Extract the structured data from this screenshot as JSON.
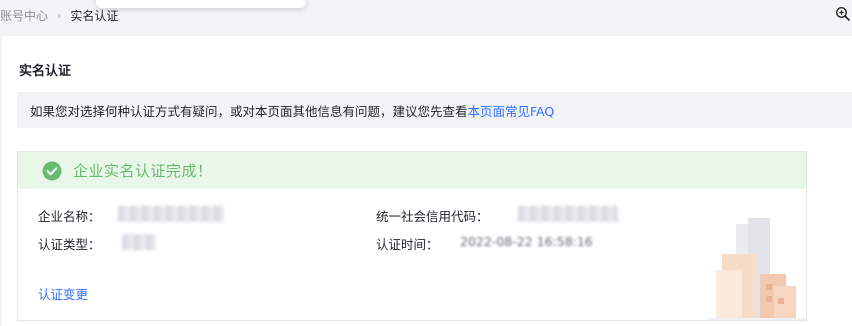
{
  "breadcrumb": {
    "items": [
      "账号中心",
      "实名认证"
    ],
    "separator": "›"
  },
  "page": {
    "title": "实名认证"
  },
  "notice": {
    "text": "如果您对选择何种认证方式有疑问，或对本页面其他信息有问题，建议您先查看",
    "link": "本页面常见FAQ"
  },
  "result": {
    "status_text": "企业实名认证完成！",
    "fields": [
      {
        "label": "企业名称：",
        "value": ""
      },
      {
        "label": "认证类型：",
        "value": ""
      },
      {
        "label": "统一社会信用代码：",
        "value": ""
      },
      {
        "label": "认证时间：",
        "value": "2022-08-22 16:58:16"
      }
    ],
    "change_link": "认证变更"
  },
  "colors": {
    "accent_blue": "#3370ff",
    "success_green": "#6aba72",
    "success_bg": "#e8f7e7",
    "notice_bg": "#f2f3f5"
  },
  "icons": {
    "success": "check-circle-icon",
    "zoom": "zoom-in-icon",
    "illustration": "building-illustration"
  }
}
